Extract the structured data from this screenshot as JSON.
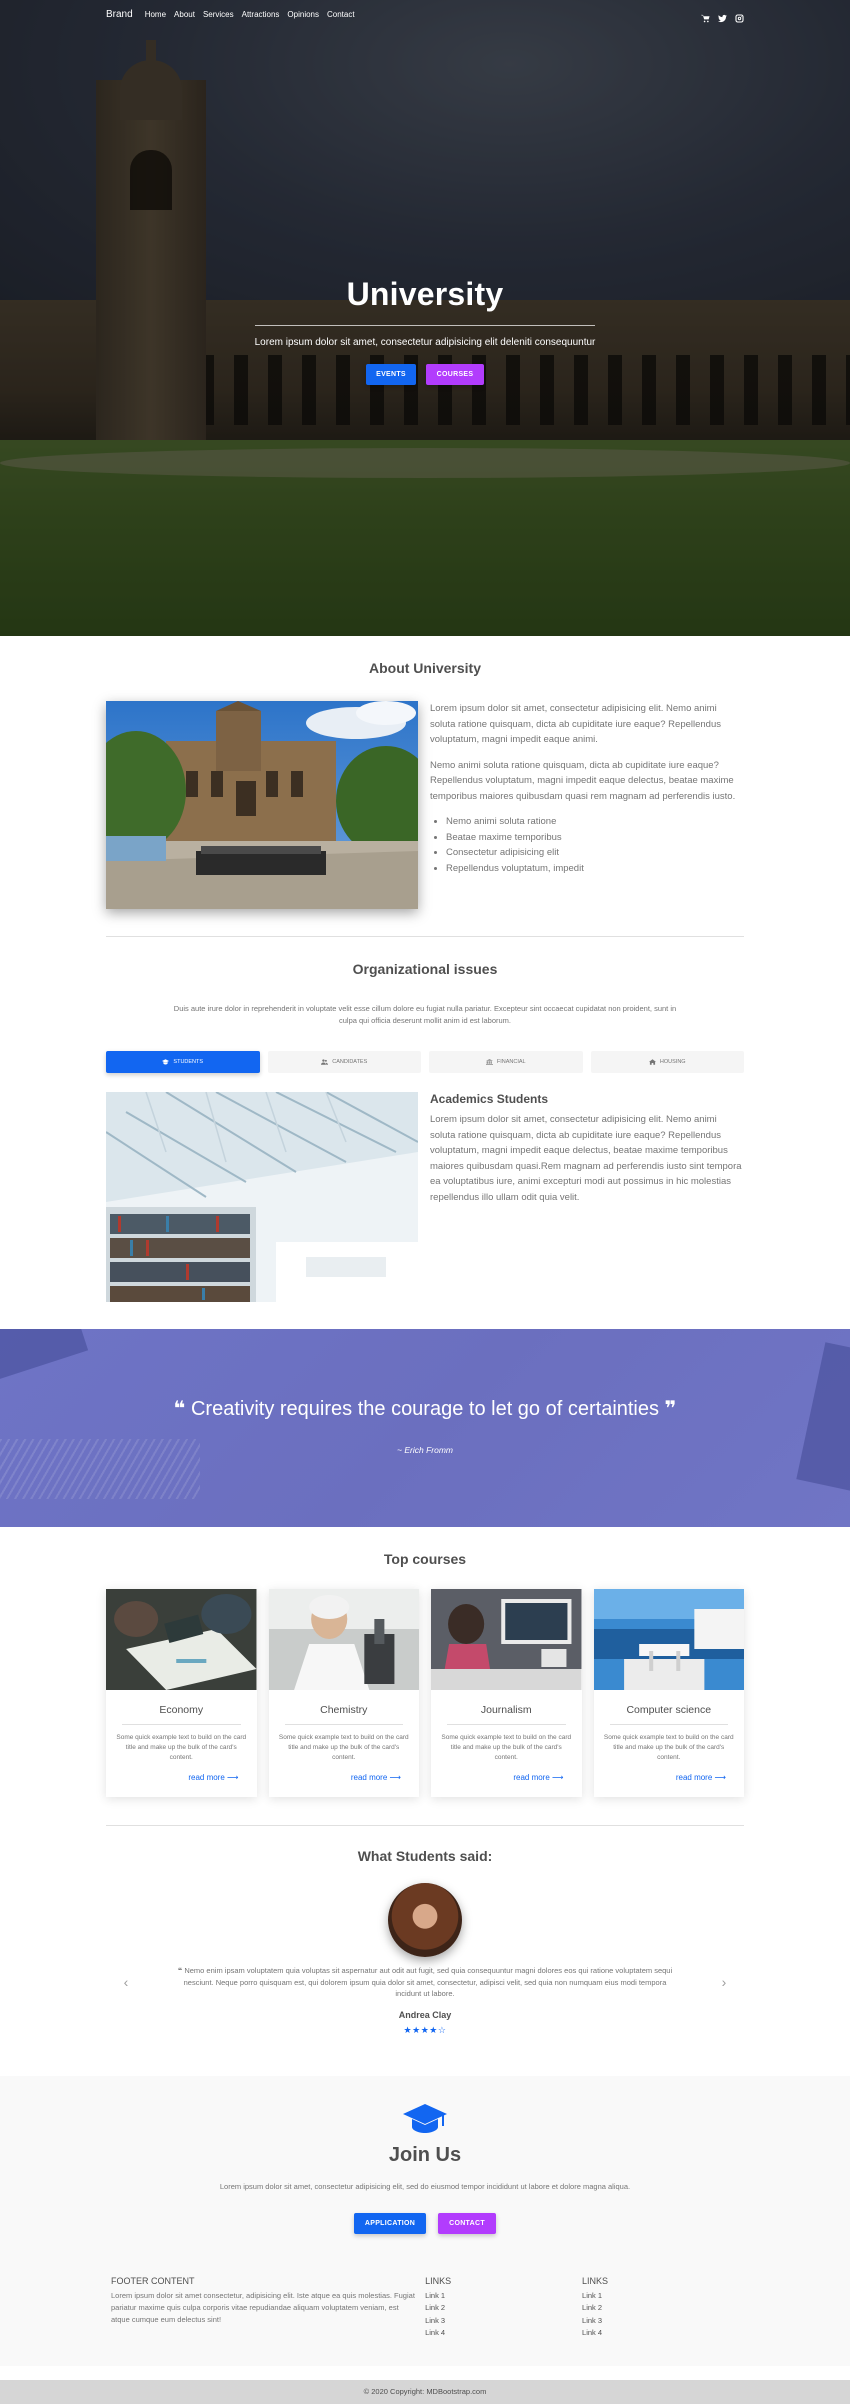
{
  "navbar": {
    "brand": "Brand",
    "links": [
      "Home",
      "About",
      "Services",
      "Attractions",
      "Opinions",
      "Contact"
    ],
    "icons": [
      "cart-icon",
      "twitter-icon",
      "instagram-icon"
    ]
  },
  "hero": {
    "title": "University",
    "subtitle": "Lorem ipsum dolor sit amet, consectetur adipisicing elit deleniti consequuntur",
    "btn_events": "EVENTS",
    "btn_courses": "COURSES"
  },
  "about": {
    "title": "About University",
    "p1": "Lorem ipsum dolor sit amet, consectetur adipisicing elit. Nemo animi soluta ratione quisquam, dicta ab cupiditate iure eaque? Repellendus voluptatum, magni impedit eaque animi.",
    "p2": "Nemo animi soluta ratione quisquam, dicta ab cupiditate iure eaque? Repellendus voluptatum, magni impedit eaque delectus, beatae maxime temporibus maiores quibusdam quasi rem magnam ad perferendis iusto.",
    "list": [
      "Nemo animi soluta ratione",
      "Beatae maxime temporibus",
      "Consectetur adipisicing elit",
      "Repellendus voluptatum, impedit"
    ]
  },
  "org": {
    "title": "Organizational issues",
    "intro": "Duis aute irure dolor in reprehenderit in voluptate velit esse cillum dolore eu fugiat nulla pariatur. Excepteur sint occaecat cupidatat non proident, sunt in culpa qui officia deserunt mollit anim id est laborum.",
    "tabs": [
      "STUDENTS",
      "CANDIDATES",
      "FINANCIAL",
      "HOUSING"
    ],
    "heading": "Academics Students",
    "text": "Lorem ipsum dolor sit amet, consectetur adipisicing elit. Nemo animi soluta ratione quisquam, dicta ab cupiditate iure eaque? Repellendus voluptatum, magni impedit eaque delectus, beatae maxime temporibus maiores quibusdam quasi.Rem magnam ad perferendis iusto sint tempora ea voluptatibus iure, animi excepturi modi aut possimus in hic molestias repellendus illo ullam odit quia velit."
  },
  "quote": {
    "text": "Creativity requires the courage to let go of certainties",
    "author": "~ Erich Fromm"
  },
  "courses": {
    "title": "Top courses",
    "items": [
      {
        "name": "Economy",
        "text": "Some quick example text to build on the card title and make up the bulk of the card's content.",
        "link": "read more"
      },
      {
        "name": "Chemistry",
        "text": "Some quick example text to build on the card title and make up the bulk of the card's content.",
        "link": "read more"
      },
      {
        "name": "Journalism",
        "text": "Some quick example text to build on the card title and make up the bulk of the card's content.",
        "link": "read more"
      },
      {
        "name": "Computer science",
        "text": "Some quick example text to build on the card title and make up the bulk of the card's content.",
        "link": "read more"
      }
    ]
  },
  "testimonial": {
    "title": "What Students said:",
    "text": "Nemo enim ipsam voluptatem quia voluptas sit aspernatur aut odit aut fugit, sed quia consequuntur magni dolores eos qui ratione voluptatem sequi nesciunt. Neque porro quisquam est, qui dolorem ipsum quia dolor sit amet, consectetur, adipisci velit, sed quia non numquam eius modi tempora incidunt ut labore.",
    "name": "Andrea Clay",
    "rating": 4,
    "rating_max": 5
  },
  "join": {
    "title": "Join Us",
    "text": "Lorem ipsum dolor sit amet, consectetur adipisicing elit, sed do eiusmod tempor incididunt ut labore et dolore magna aliqua.",
    "btn_application": "APPLICATION",
    "btn_contact": "CONTACT"
  },
  "footer": {
    "content_title": "FOOTER CONTENT",
    "content_text": "Lorem ipsum dolor sit amet consectetur, adipisicing elit. Iste atque ea quis molestias. Fugiat pariatur maxime quis culpa corporis vitae repudiandae aliquam voluptatem veniam, est atque cumque eum delectus sint!",
    "links1_title": "LINKS",
    "links1": [
      "Link 1",
      "Link 2",
      "Link 3",
      "Link 4"
    ],
    "links2_title": "LINKS",
    "links2": [
      "Link 1",
      "Link 2",
      "Link 3",
      "Link 4"
    ],
    "copyright_prefix": "© 2020 Copyright:",
    "copyright_link": "MDBootstrap.com"
  },
  "colors": {
    "primary": "#1266f1",
    "secondary": "#b23cfd",
    "quote_bg": "#6e74c6"
  }
}
